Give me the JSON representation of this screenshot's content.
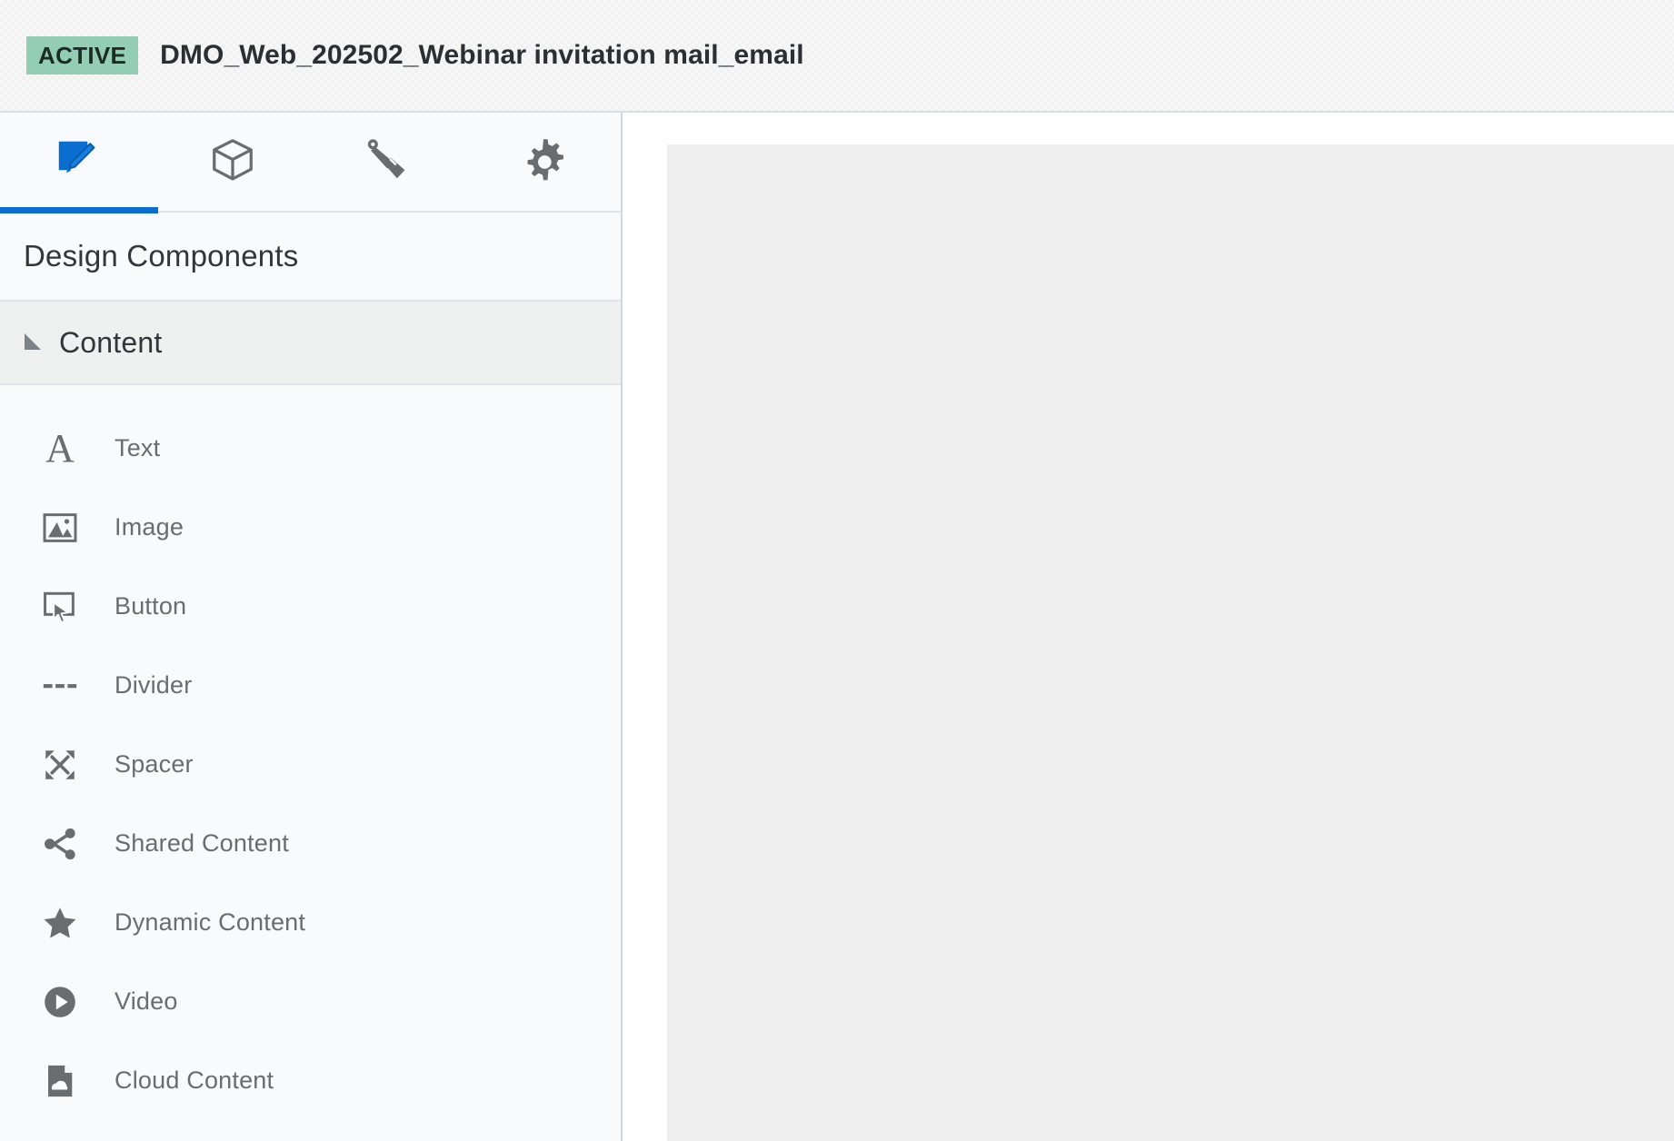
{
  "header": {
    "status_badge": "ACTIVE",
    "title": "DMO_Web_202502_Webinar invitation mail_email",
    "badge_color": "#93cdb4"
  },
  "sidebar": {
    "tabs": [
      {
        "icon": "edit-pencil-icon",
        "name": "tab-edit",
        "active": true
      },
      {
        "icon": "cube-icon",
        "name": "tab-blocks",
        "active": false
      },
      {
        "icon": "paint-brush-icon",
        "name": "tab-styles",
        "active": false
      },
      {
        "icon": "gear-icon",
        "name": "tab-settings",
        "active": false
      }
    ],
    "panel_title": "Design Components",
    "group": {
      "label": "Content",
      "expanded": true
    },
    "components": [
      {
        "label": "Text",
        "icon": "text-a-icon"
      },
      {
        "label": "Image",
        "icon": "image-icon"
      },
      {
        "label": "Button",
        "icon": "button-cursor-icon"
      },
      {
        "label": "Divider",
        "icon": "divider-dashed-icon"
      },
      {
        "label": "Spacer",
        "icon": "spacer-expand-icon"
      },
      {
        "label": "Shared Content",
        "icon": "share-nodes-icon"
      },
      {
        "label": "Dynamic Content",
        "icon": "star-icon"
      },
      {
        "label": "Video",
        "icon": "play-circle-icon"
      },
      {
        "label": "Cloud Content",
        "icon": "cloud-document-icon"
      }
    ]
  },
  "canvas": {
    "accent_color": "#0a6ed1",
    "block_color": "#eeeeee"
  }
}
